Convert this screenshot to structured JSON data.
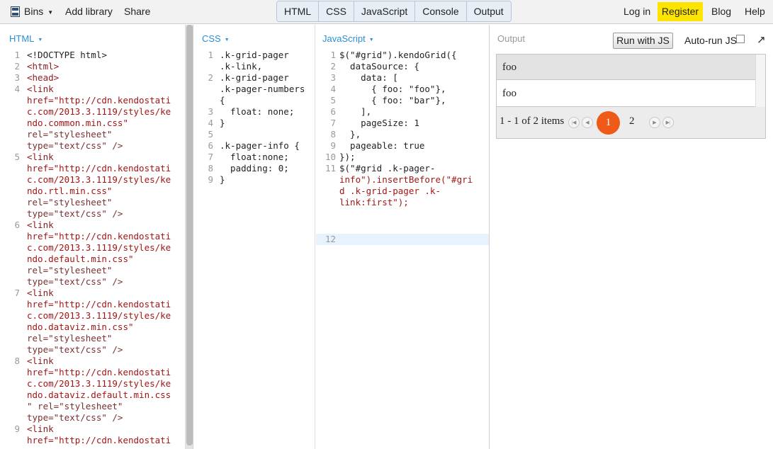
{
  "topbar": {
    "bins_label": "Bins",
    "add_library_label": "Add library",
    "share_label": "Share",
    "tabs": [
      "HTML",
      "CSS",
      "JavaScript",
      "Console",
      "Output"
    ],
    "login_label": "Log in",
    "register_label": "Register",
    "blog_label": "Blog",
    "help_label": "Help"
  },
  "panels": {
    "html_title": "HTML",
    "css_title": "CSS",
    "js_title": "JavaScript",
    "output_title": "Output"
  },
  "html_editor": {
    "line_numbers": [
      "1",
      "2",
      "3",
      "4",
      "5",
      "6",
      "7",
      "8",
      "9"
    ],
    "lines": [
      "<!DOCTYPE html>",
      "<html>",
      "<head>",
      "<link",
      "href=\"http://cdn.kendostati",
      "c.com/2013.3.1119/styles/ke",
      "ndo.common.min.css\"",
      "rel=\"stylesheet\"",
      "type=\"text/css\" />",
      "<link",
      "href=\"http://cdn.kendostati",
      "c.com/2013.3.1119/styles/ke",
      "ndo.rtl.min.css\"",
      "rel=\"stylesheet\"",
      "type=\"text/css\" />",
      "<link",
      "href=\"http://cdn.kendostati",
      "c.com/2013.3.1119/styles/ke",
      "ndo.default.min.css\"",
      "rel=\"stylesheet\"",
      "type=\"text/css\" />",
      "<link",
      "href=\"http://cdn.kendostati",
      "c.com/2013.3.1119/styles/ke",
      "ndo.dataviz.min.css\"",
      "rel=\"stylesheet\"",
      "type=\"text/css\" />",
      "<link",
      "href=\"http://cdn.kendostati",
      "c.com/2013.3.1119/styles/ke",
      "ndo.dataviz.default.min.css",
      "\" rel=\"stylesheet\"",
      "type=\"text/css\" />",
      "<link",
      "href=\"http://cdn.kendostati"
    ]
  },
  "css_editor": {
    "line_numbers": [
      "1",
      "2",
      "3",
      "4",
      "5",
      "6",
      "7",
      "8",
      "9"
    ],
    "lines": [
      ".k-grid-pager",
      ".k-link,",
      ".k-grid-pager",
      ".k-pager-numbers",
      "{",
      "  float: none;",
      "}",
      "",
      ".k-pager-info {",
      "  float:none;",
      "  padding: 0;",
      "}"
    ]
  },
  "js_editor": {
    "line_numbers": [
      "1",
      "2",
      "3",
      "4",
      "5",
      "6",
      "7",
      "8",
      "9",
      "10",
      "11",
      "12"
    ],
    "lines": [
      "$(\"#grid\").kendoGrid({",
      "  dataSource: {",
      "    data: [",
      "      { foo: \"foo\"},",
      "      { foo: \"bar\"},",
      "    ],",
      "    pageSize: 1",
      "  },",
      "  pageable: true",
      "});",
      "$(\"#grid .k-pager-",
      "info\").insertBefore(\"#gri",
      "d .k-grid-pager .k-",
      "link:first\");",
      ""
    ]
  },
  "output": {
    "run_label": "Run with JS",
    "autorun_label": "Auto-run JS",
    "autorun_checked": false,
    "expand_icon": "↗",
    "grid": {
      "header": "foo",
      "rows": [
        "foo"
      ],
      "pager_info": "1 - 1 of 2 items",
      "current_page": "1",
      "other_page": "2",
      "current_color": "#ef5a18"
    }
  },
  "colors": {
    "accent_blue": "#2b8fd6",
    "register_yellow": "#ffe400"
  }
}
